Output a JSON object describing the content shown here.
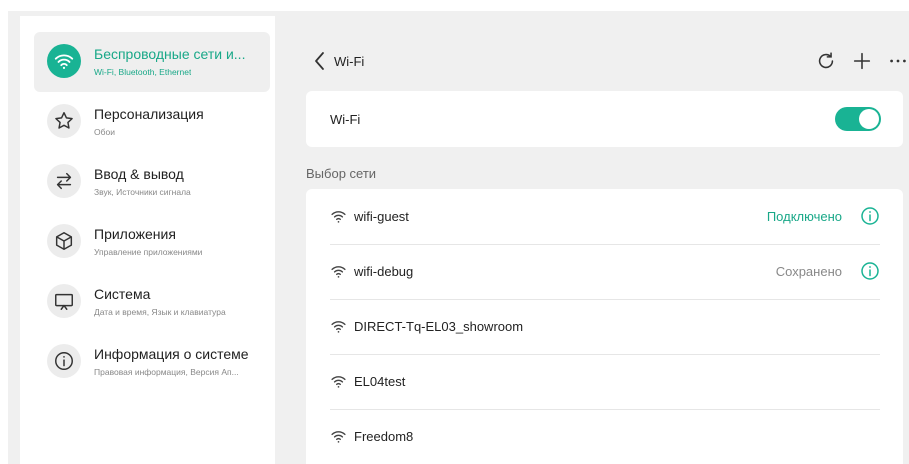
{
  "sidebar": {
    "items": [
      {
        "title": "Беспроводные сети и...",
        "subtitle": "Wi-Fi, Bluetooth, Ethernet",
        "icon": "wifi-icon",
        "active": true
      },
      {
        "title": "Персонализация",
        "subtitle": "Обои",
        "icon": "star-icon",
        "active": false
      },
      {
        "title": "Ввод & вывод",
        "subtitle": "Звук, Источники сигнала",
        "icon": "swap-arrows-icon",
        "active": false
      },
      {
        "title": "Приложения",
        "subtitle": "Управление приложениями",
        "icon": "cube-icon",
        "active": false
      },
      {
        "title": "Система",
        "subtitle": "Дата и время, Язык и клавиатура",
        "icon": "monitor-icon",
        "active": false
      },
      {
        "title": "Информация о системе",
        "subtitle": "Правовая информация, Версия Ап...",
        "icon": "info-icon",
        "active": false
      }
    ]
  },
  "header": {
    "title": "Wi-Fi",
    "icons": [
      "back-chevron-icon",
      "refresh-icon",
      "add-icon",
      "more-icon"
    ]
  },
  "wifi_toggle": {
    "label": "Wi-Fi",
    "on": true
  },
  "networks": {
    "section_title": "Выбор сети",
    "items": [
      {
        "name": "wifi-guest",
        "status": "Подключено",
        "status_type": "connected",
        "info": true
      },
      {
        "name": "wifi-debug",
        "status": "Сохранено",
        "status_type": "saved",
        "info": true
      },
      {
        "name": "DIRECT-Tq-EL03_showroom",
        "status": "",
        "status_type": "none",
        "info": false
      },
      {
        "name": "EL04test",
        "status": "",
        "status_type": "none",
        "info": false
      },
      {
        "name": "Freedom8",
        "status": "",
        "status_type": "none",
        "info": false
      }
    ]
  },
  "colors": {
    "accent": "#19b394",
    "panel": "#f0f0f0",
    "card": "#ffffff"
  }
}
